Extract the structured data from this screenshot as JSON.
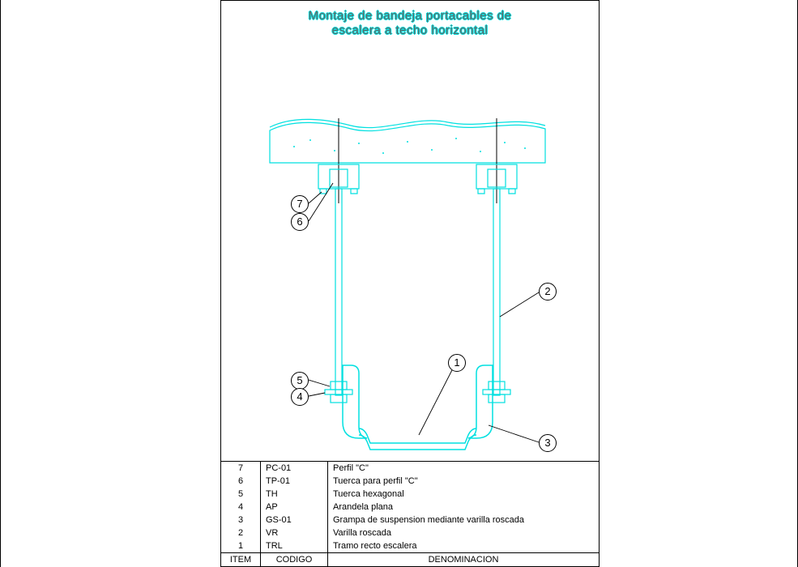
{
  "title_line1": "Montaje de bandeja portacables de",
  "title_line2": "escalera a techo horizontal",
  "callouts": {
    "1": "1",
    "2": "2",
    "3": "3",
    "4": "4",
    "5": "5",
    "6": "6",
    "7": "7"
  },
  "parts_header": {
    "item": "ITEM",
    "code": "CODIGO",
    "desc": "DENOMINACION"
  },
  "parts": [
    {
      "item": "7",
      "code": "PC-01",
      "desc": "Perfil \"C\""
    },
    {
      "item": "6",
      "code": "TP-01",
      "desc": "Tuerca para perfil \"C\""
    },
    {
      "item": "5",
      "code": "TH",
      "desc": "Tuerca hexagonal"
    },
    {
      "item": "4",
      "code": "AP",
      "desc": "Arandela plana"
    },
    {
      "item": "3",
      "code": "GS-01",
      "desc": "Grampa de suspension mediante varilla roscada"
    },
    {
      "item": "2",
      "code": "VR",
      "desc": "Varilla roscada"
    },
    {
      "item": "1",
      "code": "TRL",
      "desc": "Tramo recto escalera"
    }
  ],
  "colors": {
    "line": "#00e0e0",
    "black": "#000000"
  }
}
